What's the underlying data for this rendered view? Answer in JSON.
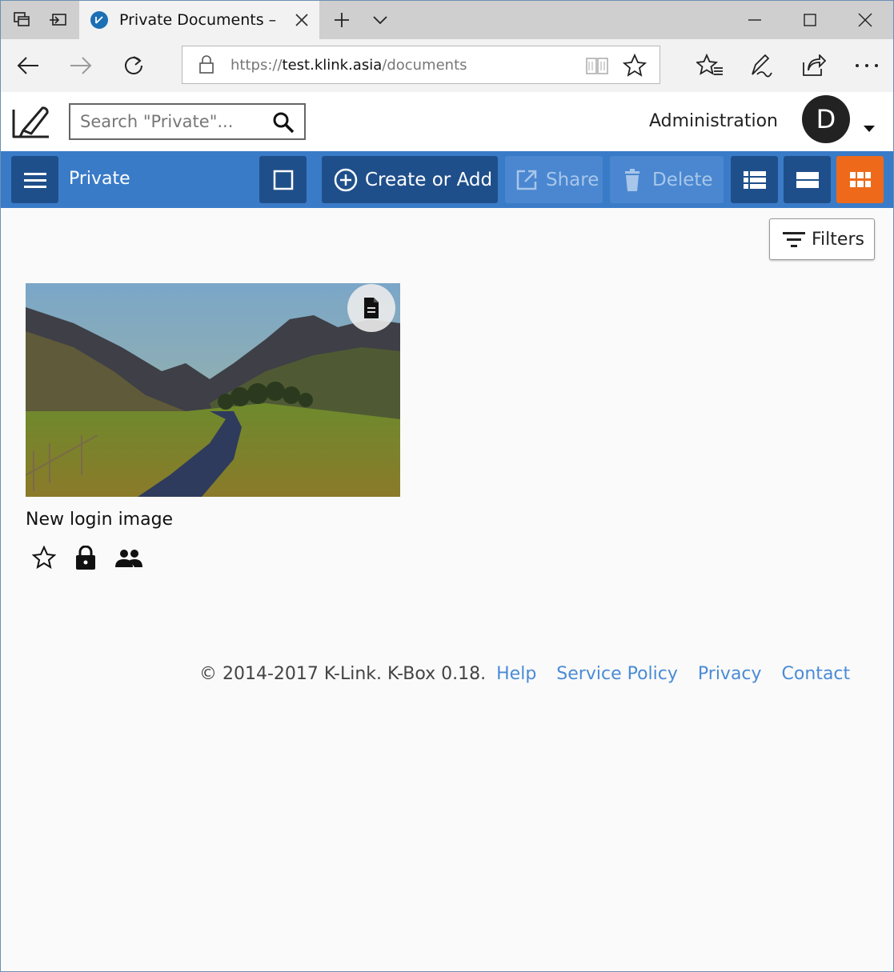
{
  "browser": {
    "tab_title": "Private Documents – K-",
    "url_scheme": "https://",
    "url_host": "test.klink.asia",
    "url_path": "/documents"
  },
  "header": {
    "search_placeholder": "Search \"Private\"...",
    "admin_label": "Administration",
    "avatar_initial": "D"
  },
  "toolbar": {
    "section_label": "Private",
    "create_label": "Create or Add",
    "share_label": "Share",
    "delete_label": "Delete"
  },
  "content": {
    "filters_label": "Filters",
    "documents": [
      {
        "title": "New login image"
      }
    ]
  },
  "footer": {
    "copyright": "© 2014-2017 K-Link. K-Box 0.18.",
    "links": [
      "Help",
      "Service Policy",
      "Privacy",
      "Contact"
    ]
  },
  "colors": {
    "toolbar_bg": "#3a7bc8",
    "button_dark": "#1f4f8a",
    "active_view": "#ee6a1a",
    "link": "#4a8bd6"
  }
}
